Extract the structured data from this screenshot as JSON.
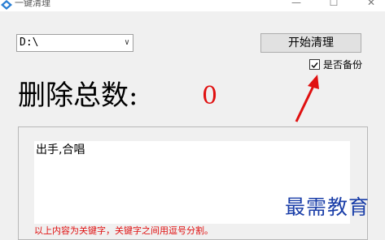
{
  "window": {
    "title": "一键清理",
    "minimize": "—",
    "maximize": "☐",
    "close": "✕"
  },
  "drive_select": {
    "value": "D:\\",
    "chevron": "∨"
  },
  "start_button": {
    "label": "开始清理"
  },
  "backup": {
    "label": "是否备份",
    "checked": true
  },
  "count": {
    "label": "删除总数:",
    "value": "0"
  },
  "keywords": {
    "text": "出手,合唱"
  },
  "hint": "以上内容为关键字，关键字之间用逗号分割。",
  "watermark": "最需教育",
  "colors": {
    "accent_red": "#e01010",
    "watermark_blue": "#1a3ea8",
    "icon_blue": "#2a7fd4"
  }
}
